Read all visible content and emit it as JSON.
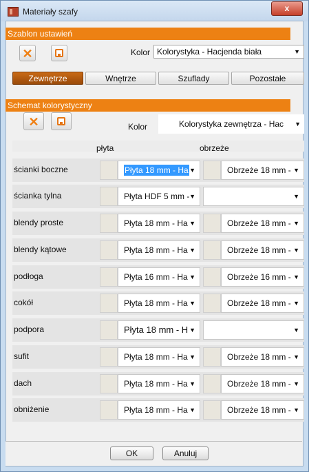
{
  "window": {
    "title": "Materiały szafy",
    "close_label": "x"
  },
  "template_section": {
    "header": "Szablon ustawień",
    "kolor_label": "Kolor",
    "kolor_value": "Kolorystyka - Hacjenda biała"
  },
  "tabs": [
    {
      "label": "Zewnętrze",
      "active": true
    },
    {
      "label": "Wnętrze",
      "active": false
    },
    {
      "label": "Szuflady",
      "active": false
    },
    {
      "label": "Pozostałe",
      "active": false
    }
  ],
  "scheme_section": {
    "header": "Schemat kolorystyczny",
    "kolor_label": "Kolor",
    "kolor_value": "Kolorystyka zewnętrza - Hac"
  },
  "table": {
    "col_plyta": "płyta",
    "col_obrzeze": "obrzeże",
    "rows": [
      {
        "label": "ścianki boczne",
        "plyta": "Płyta 18 mm - Ha",
        "obrzeze": "Obrzeże 18 mm -"
      },
      {
        "label": "ścianka tylna",
        "plyta": "Płyta HDF 5 mm -",
        "obrzeze": ""
      },
      {
        "label": "blendy proste",
        "plyta": "Płyta 18 mm - Ha",
        "obrzeze": "Obrzeże 18 mm -"
      },
      {
        "label": "blendy kątowe",
        "plyta": "Płyta 18 mm - Ha",
        "obrzeze": "Obrzeże 18 mm -"
      },
      {
        "label": "podłoga",
        "plyta": "Płyta 16 mm - Ha",
        "obrzeze": "Obrzeże 16 mm -"
      },
      {
        "label": "cokół",
        "plyta": "Płyta 18 mm - Ha",
        "obrzeze": "Obrzeże 18 mm -"
      },
      {
        "label": "podpora",
        "plyta": "Płyta 18 mm - H",
        "obrzeze": ""
      },
      {
        "label": "sufit",
        "plyta": "Płyta 18 mm - Ha",
        "obrzeze": "Obrzeże 18 mm -"
      },
      {
        "label": "dach",
        "plyta": "Płyta 18 mm - Ha",
        "obrzeze": "Obrzeże 18 mm -"
      },
      {
        "label": "obniżenie",
        "plyta": "Płyta 18 mm - Ha",
        "obrzeze": "Obrzeże 18 mm -"
      }
    ]
  },
  "buttons": {
    "ok": "OK",
    "cancel": "Anuluj"
  },
  "colors": {
    "accent": "#ed8113",
    "active_tab": "#b05a10",
    "swatch": "#e9e6dd",
    "selection": "#3399ff"
  }
}
